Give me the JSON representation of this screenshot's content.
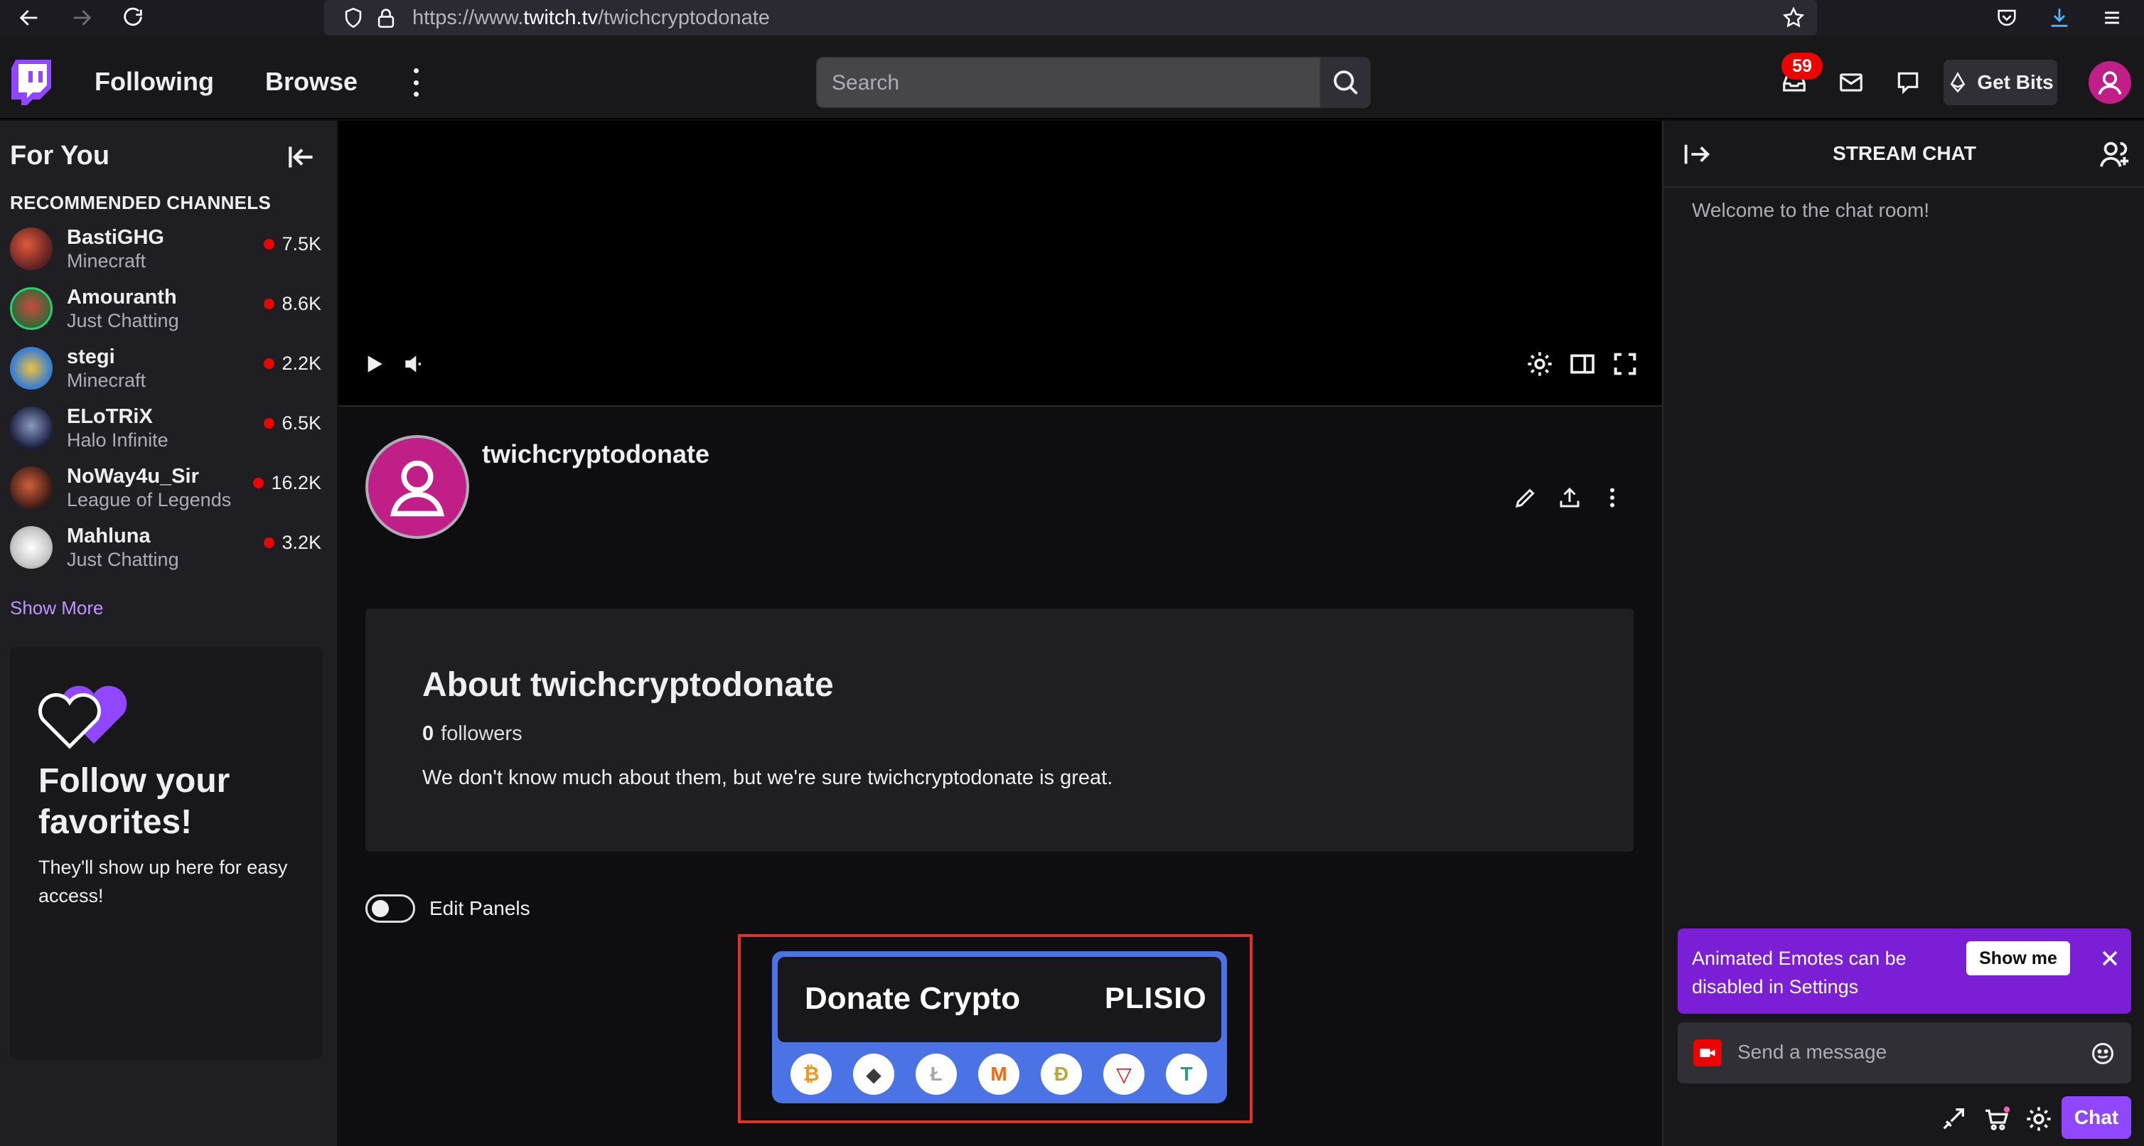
{
  "browser": {
    "url_prefix": "https://www.",
    "url_host": "twitch.tv",
    "url_path": "/twichcryptodonate"
  },
  "topnav": {
    "following": "Following",
    "browse": "Browse",
    "search_placeholder": "Search",
    "notifications_count": "59",
    "get_bits": "Get Bits"
  },
  "sidebar": {
    "title": "For You",
    "section": "RECOMMENDED CHANNELS",
    "channels": [
      {
        "name": "BastiGHG",
        "game": "Minecraft",
        "viewers": "7.5K"
      },
      {
        "name": "Amouranth",
        "game": "Just Chatting",
        "viewers": "8.6K"
      },
      {
        "name": "stegi",
        "game": "Minecraft",
        "viewers": "2.2K"
      },
      {
        "name": "ELoTRiX",
        "game": "Halo Infinite",
        "viewers": "6.5K"
      },
      {
        "name": "NoWay4u_Sir",
        "game": "League of Legends",
        "viewers": "16.2K"
      },
      {
        "name": "Mahluna",
        "game": "Just Chatting",
        "viewers": "3.2K"
      }
    ],
    "show_more": "Show More",
    "follow_card": {
      "title": "Follow your favorites!",
      "text": "They'll show up here for easy access!"
    }
  },
  "channel": {
    "name": "twichcryptodonate",
    "about_title": "About twichcryptodonate",
    "followers_count": "0",
    "followers_label": "followers",
    "description": "We don't know much about them, but we're sure twichcryptodonate is great.",
    "edit_panels": "Edit Panels"
  },
  "panel": {
    "donate": "Donate Crypto",
    "brand": "PLISIO",
    "coins": [
      {
        "name": "bitcoin",
        "glyph": "₿",
        "color": "#f7931a"
      },
      {
        "name": "ethereum",
        "glyph": "◆",
        "color": "#3c3c3d"
      },
      {
        "name": "litecoin",
        "glyph": "Ł",
        "color": "#a6a9aa"
      },
      {
        "name": "monero",
        "glyph": "M",
        "color": "#ff6600"
      },
      {
        "name": "dogecoin",
        "glyph": "Ð",
        "color": "#c2a633"
      },
      {
        "name": "tron",
        "glyph": "▽",
        "color": "#e50915"
      },
      {
        "name": "tether",
        "glyph": "T",
        "color": "#26a17b"
      }
    ]
  },
  "chat": {
    "title": "STREAM CHAT",
    "welcome": "Welcome to the chat room!",
    "emote_text": "Animated Emotes can be disabled in Settings",
    "show_me": "Show me",
    "message_placeholder": "Send a message",
    "chat_button": "Chat"
  }
}
